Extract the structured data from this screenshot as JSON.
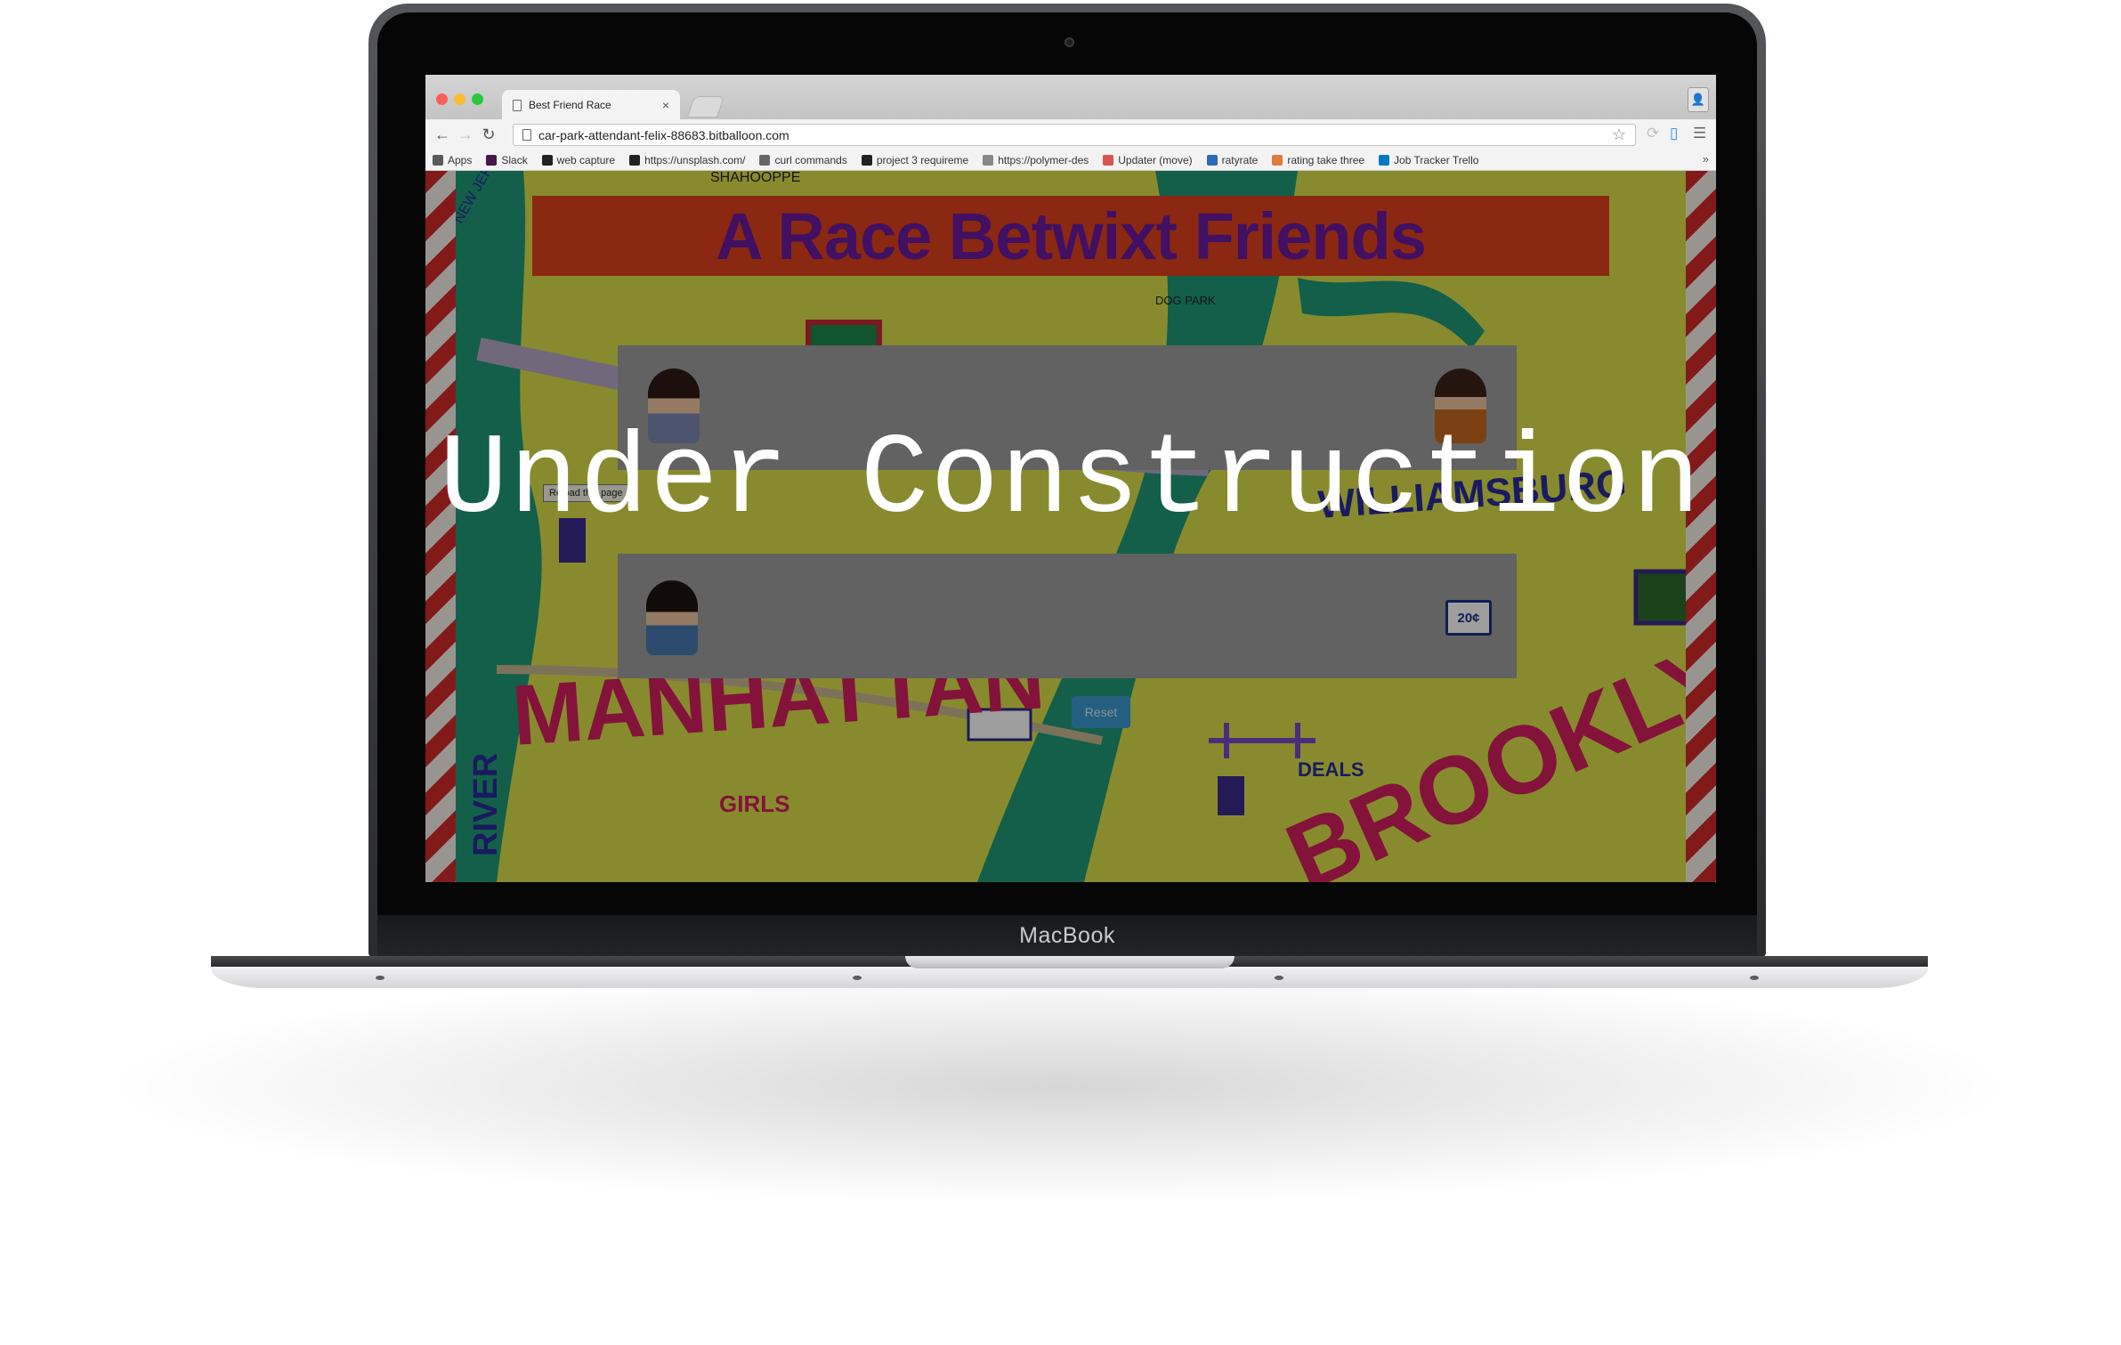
{
  "device": {
    "brand": "MacBook"
  },
  "browser": {
    "tab_title": "Best Friend Race",
    "url": "car-park-attendant-felix-88683.bitballoon.com",
    "bookmarks": [
      {
        "label": "Apps",
        "icon": "apps-grid-icon",
        "color": "#5a5a5a"
      },
      {
        "label": "Slack",
        "icon": "slack-icon",
        "color": "#4a154b"
      },
      {
        "label": "web capture",
        "icon": "github-icon",
        "color": "#222222"
      },
      {
        "label": "https://unsplash.com/",
        "icon": "camera-icon",
        "color": "#222222"
      },
      {
        "label": "curl commands",
        "icon": "slashes-icon",
        "color": "#666666"
      },
      {
        "label": "project 3 requireme",
        "icon": "github-icon",
        "color": "#222222"
      },
      {
        "label": "https://polymer-des",
        "icon": "document-icon",
        "color": "#888888"
      },
      {
        "label": "Updater (move)",
        "icon": "updater-icon",
        "color": "#d9534f"
      },
      {
        "label": "ratyrate",
        "icon": "ratyrate-icon",
        "color": "#2a6db5"
      },
      {
        "label": "rating take three",
        "icon": "rating-icon",
        "color": "#e07b39"
      },
      {
        "label": "Job Tracker Trello",
        "icon": "trello-icon",
        "color": "#0079bf"
      }
    ],
    "more_bookmarks": "»"
  },
  "page": {
    "title": "A Race Betwixt Friends",
    "reset_label": "Reset",
    "tooltip": "Reload this page",
    "overlay_text": "Under Construction",
    "finish_price": "20¢",
    "map_labels": [
      "MANHATTAN",
      "WILLIAMSBURG",
      "BROOKLYN",
      "RIVER",
      "GIRLS GIRLS GIRLS",
      "DEALS DEALS DEALS",
      "NEW JERSEY",
      "DOG PARK",
      "SHAHOOPPE"
    ]
  },
  "colors": {
    "title_bar": "#e0421c",
    "title_text": "#6a1aa0",
    "map_yellow": "#dbe04a",
    "map_water": "#1f9a78",
    "reset_button": "#3a9ad0"
  }
}
